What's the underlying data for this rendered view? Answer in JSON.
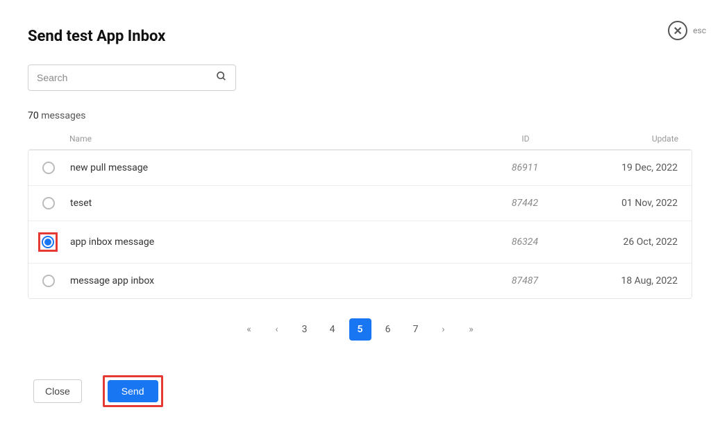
{
  "header": {
    "title": "Send test App Inbox",
    "esc_label": "esc"
  },
  "search": {
    "placeholder": "Search"
  },
  "count": {
    "number": "70",
    "label": "messages"
  },
  "columns": {
    "name": "Name",
    "id": "ID",
    "update": "Update"
  },
  "rows": [
    {
      "name": "new pull message",
      "id": "86911",
      "update": "19 Dec, 2022",
      "selected": false,
      "highlighted": false
    },
    {
      "name": "teset",
      "id": "87442",
      "update": "01 Nov, 2022",
      "selected": false,
      "highlighted": false
    },
    {
      "name": "app inbox message",
      "id": "86324",
      "update": "26 Oct, 2022",
      "selected": true,
      "highlighted": true
    },
    {
      "name": "message app inbox",
      "id": "87487",
      "update": "18 Aug, 2022",
      "selected": false,
      "highlighted": false
    }
  ],
  "pagination": {
    "pages": [
      "3",
      "4",
      "5",
      "6",
      "7"
    ],
    "current": "5"
  },
  "footer": {
    "close": "Close",
    "send": "Send"
  }
}
